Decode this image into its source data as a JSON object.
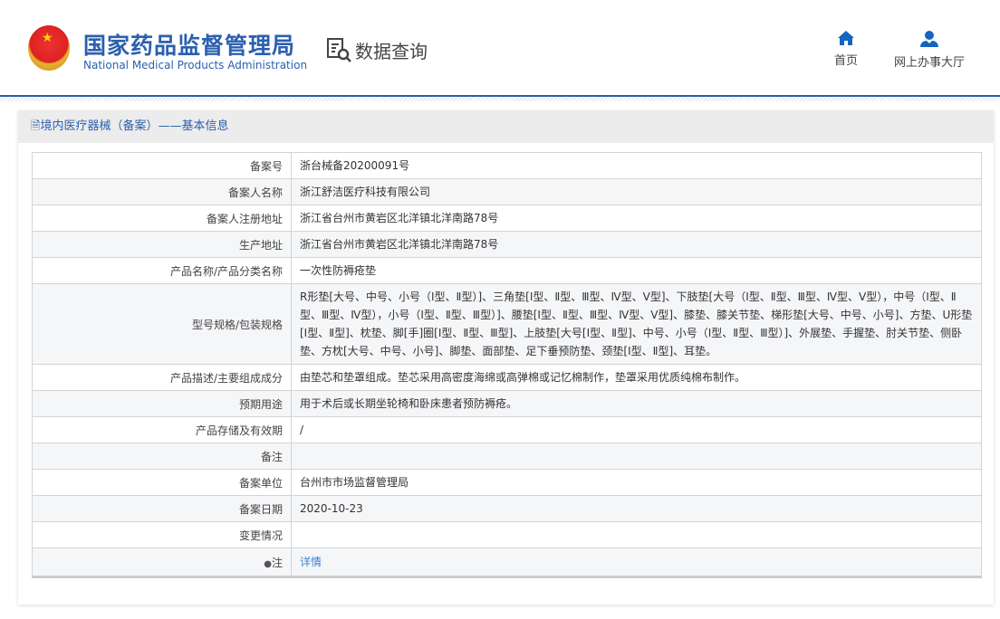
{
  "header": {
    "title_cn": "国家药品监督管理局",
    "title_en": "National Medical Products Administration",
    "section": "数据查询",
    "nav": [
      {
        "label": "首页",
        "icon": "home-icon"
      },
      {
        "label": "网上办事大厅",
        "icon": "user-icon"
      }
    ]
  },
  "panel": {
    "title": "境内医疗器械（备案）——基本信息"
  },
  "rows": [
    {
      "label": "备案号",
      "value": "浙台械备20200091号"
    },
    {
      "label": "备案人名称",
      "value": "浙江舒洁医疗科技有限公司"
    },
    {
      "label": "备案人注册地址",
      "value": "浙江省台州市黄岩区北洋镇北洋南路78号"
    },
    {
      "label": "生产地址",
      "value": "浙江省台州市黄岩区北洋镇北洋南路78号"
    },
    {
      "label": "产品名称/产品分类名称",
      "value": "一次性防褥疮垫"
    },
    {
      "label": "型号规格/包装规格",
      "value": "R形垫[大号、中号、小号（Ⅰ型、Ⅱ型）]、三角垫[Ⅰ型、Ⅱ型、Ⅲ型、Ⅳ型、Ⅴ型]、下肢垫[大号（Ⅰ型、Ⅱ型、Ⅲ型、Ⅳ型、Ⅴ型），中号（Ⅰ型、Ⅱ型、Ⅲ型、Ⅳ型），小号（Ⅰ型、Ⅱ型、Ⅲ型）]、腰垫[Ⅰ型、Ⅱ型、Ⅲ型、Ⅳ型、Ⅴ型]、膝垫、膝关节垫、梯形垫[大号、中号、小号]、方垫、U形垫[Ⅰ型、Ⅱ型]、枕垫、脚[手]圈[Ⅰ型、Ⅱ型、Ⅲ型]、上肢垫[大号[Ⅰ型、Ⅱ型]、中号、小号（Ⅰ型、Ⅱ型、Ⅲ型）]、外展垫、手握垫、肘关节垫、侧卧垫、方枕[大号、中号、小号]、脚垫、面部垫、足下垂预防垫、颈垫[Ⅰ型、Ⅱ型]、耳垫。"
    },
    {
      "label": "产品描述/主要组成成分",
      "value": "由垫芯和垫罩组成。垫芯采用高密度海绵或高弹棉或记忆棉制作，垫罩采用优质纯棉布制作。"
    },
    {
      "label": "预期用途",
      "value": "用于术后或长期坐轮椅和卧床患者预防褥疮。"
    },
    {
      "label": "产品存储及有效期",
      "value": "/"
    },
    {
      "label": "备注",
      "value": ""
    },
    {
      "label": "备案单位",
      "value": "台州市市场监督管理局"
    },
    {
      "label": "备案日期",
      "value": "2020-10-23"
    },
    {
      "label": "变更情况",
      "value": ""
    },
    {
      "label": "注",
      "value": "详情"
    }
  ]
}
